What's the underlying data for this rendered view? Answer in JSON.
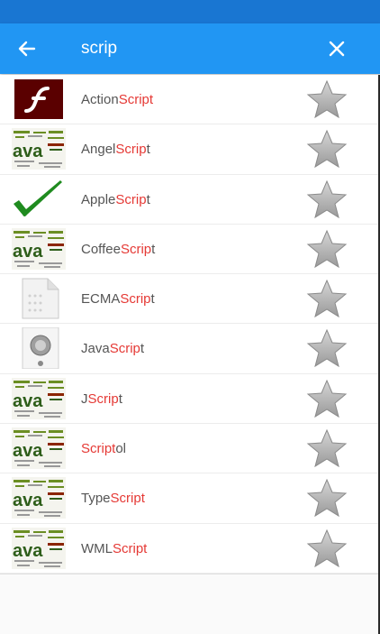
{
  "search": {
    "query": "scrip"
  },
  "colors": {
    "appbar": "#2196f3",
    "statusbar": "#1976d2",
    "highlight": "#e53935"
  },
  "results": [
    {
      "pre": "Action",
      "hl": "Script",
      "post": "",
      "icon": "flash-icon"
    },
    {
      "pre": "Angel",
      "hl": "Scrip",
      "post": "t",
      "icon": "java-wordcloud-icon"
    },
    {
      "pre": "Apple",
      "hl": "Scrip",
      "post": "t",
      "icon": "checkmark-icon"
    },
    {
      "pre": "Coffee",
      "hl": "Scrip",
      "post": "t",
      "icon": "java-wordcloud-icon"
    },
    {
      "pre": "ECMA",
      "hl": "Scrip",
      "post": "t",
      "icon": "document-icon"
    },
    {
      "pre": "Java",
      "hl": "Scrip",
      "post": "t",
      "icon": "speaker-icon"
    },
    {
      "pre": "J",
      "hl": "Scrip",
      "post": "t",
      "icon": "java-wordcloud-icon"
    },
    {
      "pre": "",
      "hl": "Script",
      "post": "ol",
      "icon": "java-wordcloud-icon"
    },
    {
      "pre": "Type",
      "hl": "Script",
      "post": "",
      "icon": "java-wordcloud-icon"
    },
    {
      "pre": "WML",
      "hl": "Script",
      "post": "",
      "icon": "java-wordcloud-icon"
    }
  ]
}
